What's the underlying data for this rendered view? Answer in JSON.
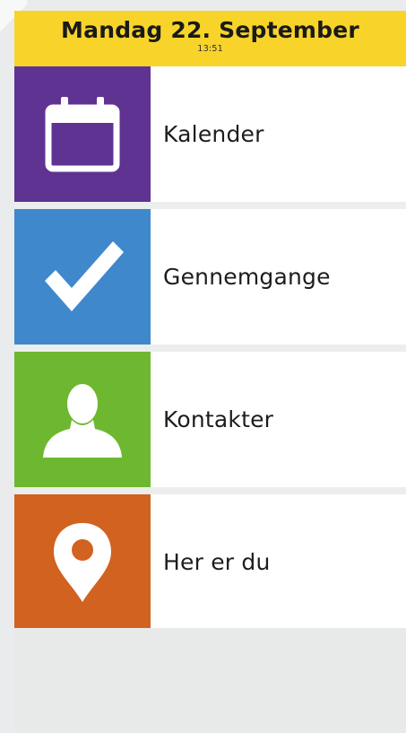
{
  "header": {
    "date": "Mandag 22. September",
    "time": "13:51",
    "background": "#f8d42a"
  },
  "menu": {
    "items": [
      {
        "label": "Kalender",
        "icon": "calendar-icon",
        "color": "#5f3391"
      },
      {
        "label": "Gennemgange",
        "icon": "checkmark-icon",
        "color": "#3f88cc"
      },
      {
        "label": "Kontakter",
        "icon": "person-icon",
        "color": "#6db830"
      },
      {
        "label": "Her er du",
        "icon": "location-pin-icon",
        "color": "#d2621f"
      }
    ]
  }
}
